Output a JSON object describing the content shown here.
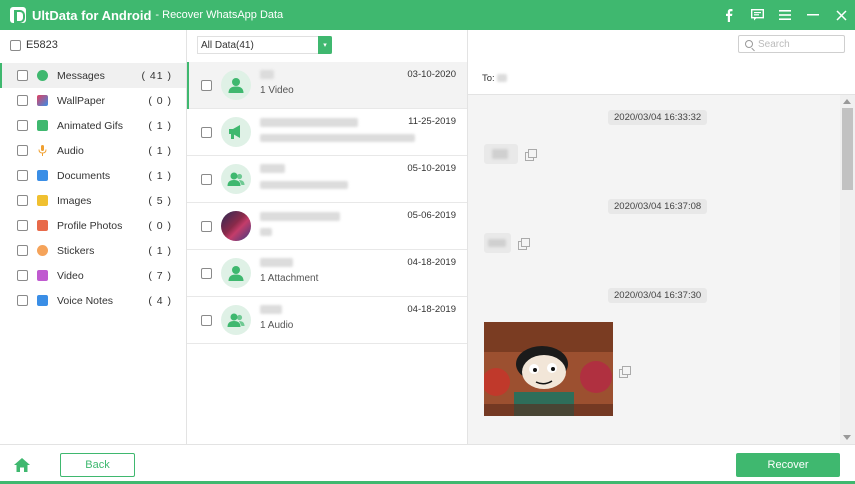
{
  "titlebar": {
    "app_name": "UltData for Android",
    "separator_title": "- Recover WhatsApp Data",
    "accent": "#3fb86f",
    "controls": [
      "facebook-icon",
      "feedback-icon",
      "menu-icon",
      "minimize-icon",
      "close-icon"
    ]
  },
  "device": {
    "name": "E5823"
  },
  "categories": [
    {
      "label": "Messages",
      "count": "( 41 )",
      "icon": "message-icon",
      "color": "#3fb86f"
    },
    {
      "label": "WallPaper",
      "count": "( 0 )",
      "icon": "wallpaper-icon",
      "color": "#e04060"
    },
    {
      "label": "Animated Gifs",
      "count": "( 1 )",
      "icon": "gif-icon",
      "color": "#3fb86f"
    },
    {
      "label": "Audio",
      "count": "( 1 )",
      "icon": "audio-icon",
      "color": "#f0a030"
    },
    {
      "label": "Documents",
      "count": "( 1 )",
      "icon": "document-icon",
      "color": "#3a8ee6"
    },
    {
      "label": "Images",
      "count": "( 5 )",
      "icon": "image-icon",
      "color": "#f0c030"
    },
    {
      "label": "Profile Photos",
      "count": "( 0 )",
      "icon": "profile-photo-icon",
      "color": "#e86a4a"
    },
    {
      "label": "Stickers",
      "count": "( 1 )",
      "icon": "sticker-icon",
      "color": "#f5a35a"
    },
    {
      "label": "Video",
      "count": "( 7 )",
      "icon": "video-icon",
      "color": "#c05ad0"
    },
    {
      "label": "Voice Notes",
      "count": "( 4 )",
      "icon": "voice-note-icon",
      "color": "#3a8ee6"
    }
  ],
  "filter": {
    "value": "All Data(41)"
  },
  "conversations": [
    {
      "date": "03-10-2020",
      "subtitle": "1 Video",
      "avatar": "contact-icon"
    },
    {
      "date": "11-25-2019",
      "subtitle": "",
      "avatar": "broadcast-icon"
    },
    {
      "date": "05-10-2019",
      "subtitle": "",
      "avatar": "group-icon"
    },
    {
      "date": "05-06-2019",
      "subtitle": "",
      "avatar": "photo"
    },
    {
      "date": "04-18-2019",
      "subtitle": "1 Attachment",
      "avatar": "contact-icon"
    },
    {
      "date": "04-18-2019",
      "subtitle": "1 Audio",
      "avatar": "group-icon"
    }
  ],
  "search": {
    "placeholder": "Search"
  },
  "chat": {
    "to_label": "To:",
    "timestamps": [
      "2020/03/04 16:33:32",
      "2020/03/04 16:37:08",
      "2020/03/04 16:37:30"
    ]
  },
  "footer": {
    "back_label": "Back",
    "recover_label": "Recover"
  }
}
